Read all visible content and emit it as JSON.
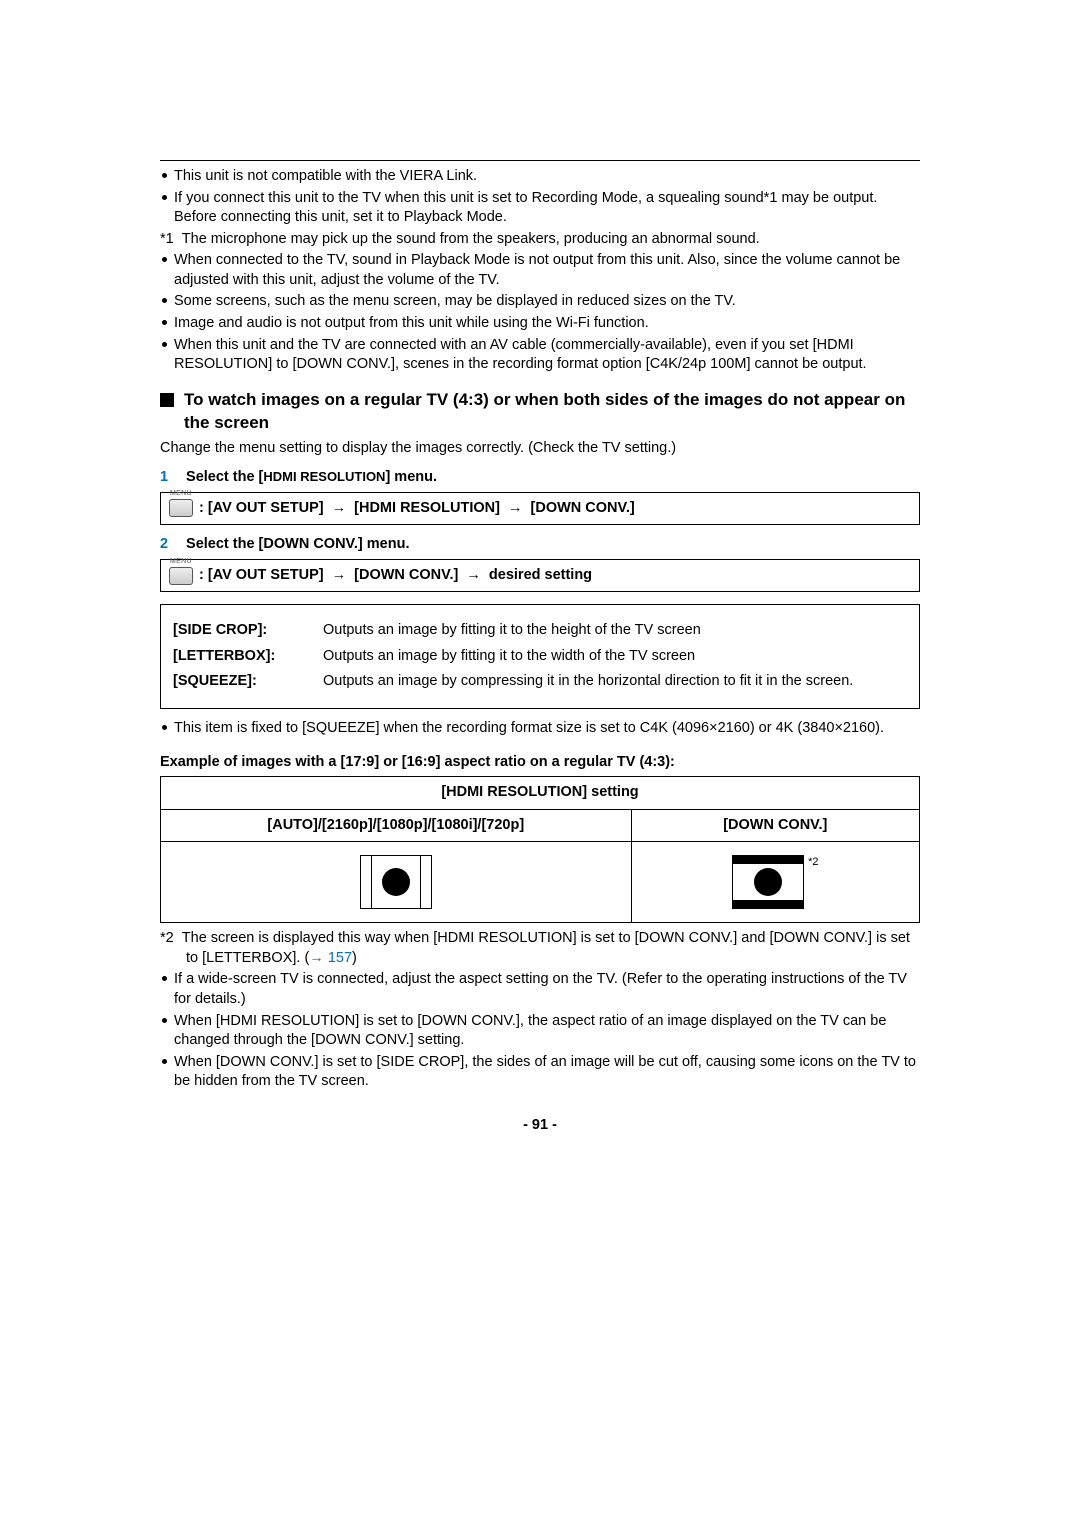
{
  "notes_top": [
    "This unit is not compatible with the VIERA Link.",
    "If you connect this unit to the TV when this unit is set to Recording Mode, a squealing sound*1 may be output. Before connecting this unit, set it to Playback Mode."
  ],
  "fn1_mark": "*1",
  "fn1_text": "The microphone may pick up the sound from the speakers, producing an abnormal sound.",
  "notes_top_after_fn": [
    "When connected to the TV, sound in Playback Mode is not output from this unit. Also, since the volume cannot be adjusted with this unit, adjust the volume of the TV.",
    "Some screens, such as the menu screen, may be displayed in reduced sizes on the TV.",
    "Image and audio is not output from this unit while using the Wi-Fi function.",
    "When this unit and the TV are connected with an AV cable (commercially-available), even if you set [HDMI RESOLUTION] to [DOWN CONV.], scenes in the recording format option [C4K/24p 100M] cannot be output."
  ],
  "section_title": "To watch images on a regular TV (4:3) or when both sides of the images do not appear on the screen",
  "section_desc": "Change the menu setting to display the images correctly. (Check the TV setting.)",
  "step1_num": "1",
  "step1_text_pre": "Select the [",
  "step1_text_mid": "HDMI RESOLUTION",
  "step1_text_post": "] menu.",
  "menu_icon_label": "MENU",
  "menu1_path1": "[AV OUT SETUP]",
  "menu1_path2": "[HDMI RESOLUTION]",
  "menu1_path3": "[DOWN CONV.]",
  "step2_num": "2",
  "step2_text": "Select the [DOWN CONV.] menu.",
  "menu2_path1": "[AV OUT SETUP]",
  "menu2_path2": "[DOWN CONV.]",
  "menu2_path3": "desired setting",
  "options": [
    {
      "name": "[SIDE CROP]:",
      "desc": "Outputs an image by fitting it to the height of the TV screen"
    },
    {
      "name": "[LETTERBOX]:",
      "desc": "Outputs an image by fitting it to the width of the TV screen"
    },
    {
      "name": "[SQUEEZE]:",
      "desc": "Outputs an image by compressing it in the horizontal direction to fit it in the screen."
    }
  ],
  "squeeze_note": "This item is fixed to [SQUEEZE] when the recording format size is set to C4K (4096×2160) or 4K (3840×2160).",
  "example_caption": "Example of images with a [17:9] or [16:9] aspect ratio on a regular TV (4:3):",
  "table": {
    "header_span": "[HDMI RESOLUTION] setting",
    "col1": "[AUTO]/[2160p]/[1080p]/[1080i]/[720p]",
    "col2": "[DOWN CONV.]",
    "star2": "*2"
  },
  "fn2_mark": "*2",
  "fn2_text_a": "The screen is displayed this way when [HDMI RESOLUTION] is set to [DOWN CONV.] and [DOWN CONV.] is set to [LETTERBOX]. (",
  "fn2_link_arrow": "→",
  "fn2_link": "157",
  "fn2_text_b": ")",
  "notes_bottom": [
    "If a wide-screen TV is connected, adjust the aspect setting on the TV. (Refer to the operating instructions of the TV for details.)",
    "When [HDMI RESOLUTION] is set to [DOWN CONV.], the aspect ratio of an image displayed on the TV can be changed through the [DOWN CONV.] setting.",
    "When [DOWN CONV.] is set to [SIDE CROP], the sides of an image will be cut off, causing some icons on the TV to be hidden from the TV screen."
  ],
  "page_number": "- 91 -"
}
